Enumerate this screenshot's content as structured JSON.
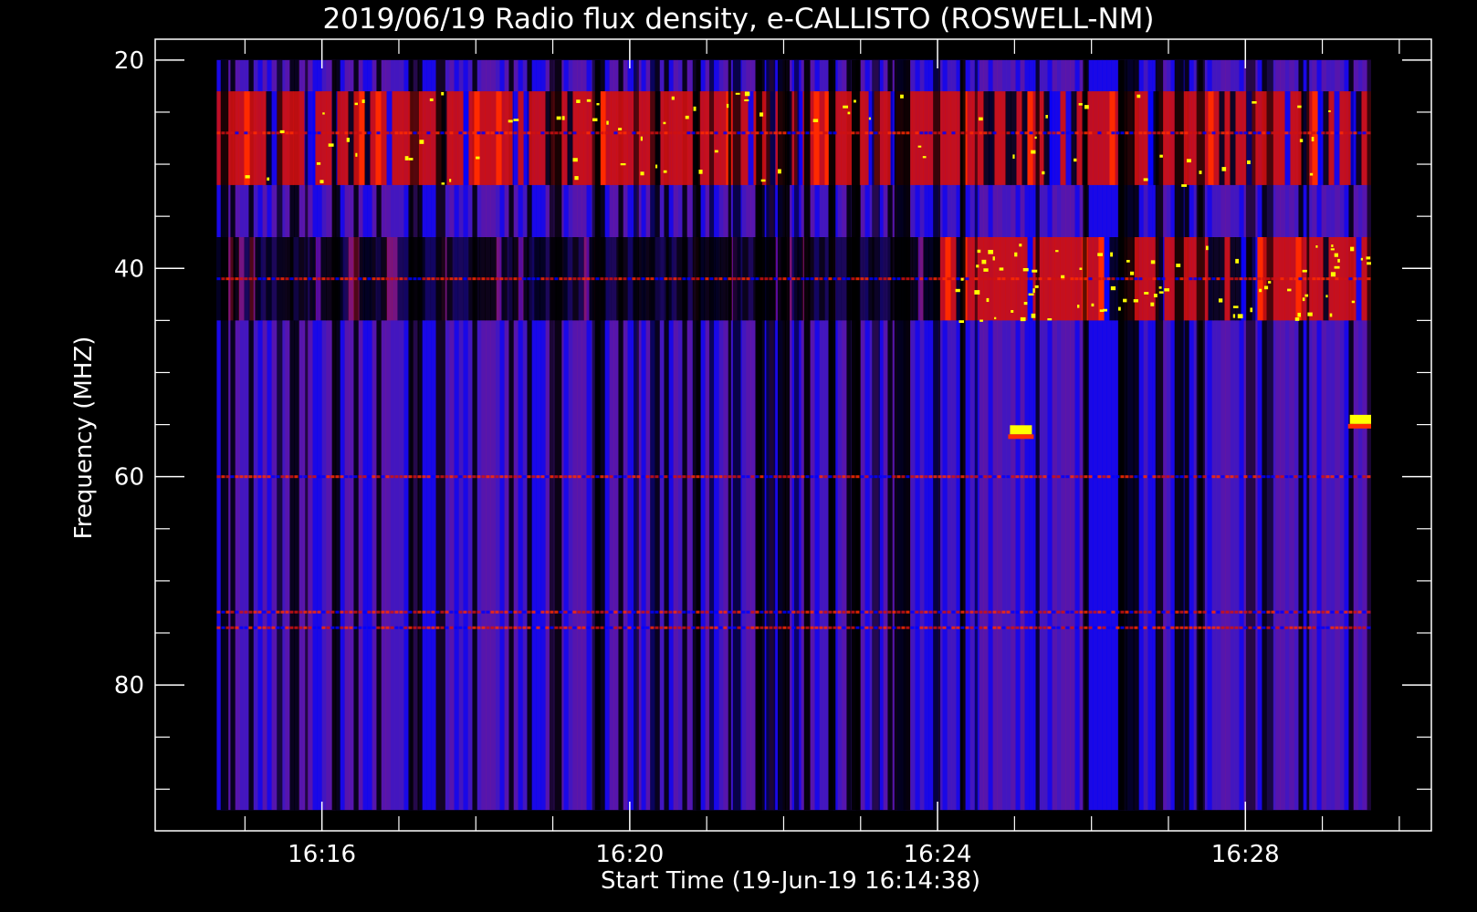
{
  "chart_data": {
    "type": "heatmap",
    "title": "2019/06/19  Radio flux density, e-CALLISTO (ROSWELL-NM)",
    "xlabel": "Start Time (19-Jun-19 16:14:38)",
    "ylabel": "Frequency (MHZ)",
    "x_start_minutes": 0,
    "x_end_minutes": 15.0,
    "xlim": [
      "16:13:50",
      "16:30:25"
    ],
    "ylim": [
      18,
      94
    ],
    "y_inverted": true,
    "x_ticks": [
      "16:16",
      "16:20",
      "16:24",
      "16:28"
    ],
    "y_ticks": [
      20,
      40,
      60,
      80
    ],
    "colormap": [
      "#000000",
      "#0000ff",
      "#7a1a8c",
      "#d01010",
      "#ff2a00",
      "#ffff00"
    ],
    "bands": [
      {
        "freq_range": [
          20,
          23
        ],
        "intensity": "low"
      },
      {
        "freq_range": [
          23,
          32
        ],
        "intensity": "high"
      },
      {
        "freq_range": [
          32,
          37
        ],
        "intensity": "low"
      },
      {
        "freq_range": [
          37,
          45
        ],
        "intensity_before_1624": "none",
        "intensity_after_1624": "high"
      },
      {
        "freq_range": [
          45,
          92
        ],
        "intensity": "low"
      }
    ],
    "horizontal_lines_mhz": [
      27,
      41,
      60,
      73,
      74.5
    ],
    "bright_spots": [
      {
        "time": "16:25:05",
        "freq": 55.5
      },
      {
        "time": "16:29:30",
        "freq": 54.5
      }
    ]
  }
}
